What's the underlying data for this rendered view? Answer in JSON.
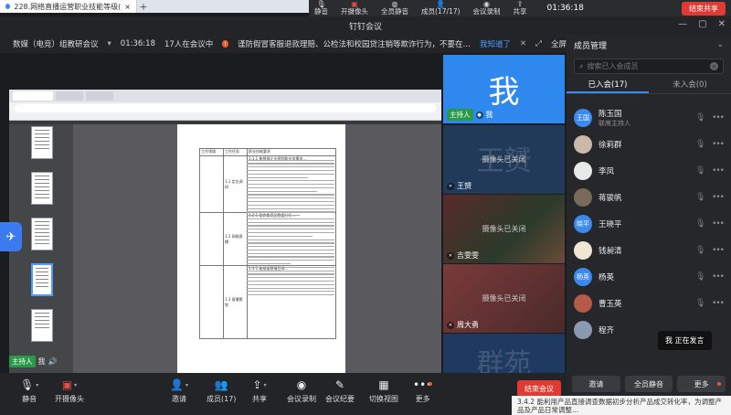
{
  "browser": {
    "tab_title": "228.网络直播运营职业技能等级(",
    "new_tab": "+"
  },
  "topbar": {
    "items": [
      {
        "icon": "mic-icon",
        "label": "静音"
      },
      {
        "icon": "camera-icon",
        "label": "开摄像头"
      },
      {
        "icon": "mute-all-icon",
        "label": "全员静音"
      },
      {
        "icon": "members-icon",
        "label": "成员(17/17)"
      },
      {
        "icon": "record-icon",
        "label": "会议录制"
      },
      {
        "icon": "share-icon",
        "label": "共享"
      }
    ],
    "time": "01:36:18",
    "end_share": "结束共享"
  },
  "window": {
    "title": "钉钉会议"
  },
  "infobar": {
    "meeting_name": "数媒（电竞）组教研会议",
    "time": "01:36:18",
    "count": "17人在会议中",
    "warning": "谨防假冒客服退款理赔、公检法和校园贷注销等欺诈行为，不要在“共享屏幕”时…",
    "ack": "我知道了",
    "fullscreen": "全屏"
  },
  "shared_doc": {
    "rows": [
      [
        "工作领域",
        "工作任务",
        "职业技能要求"
      ],
      [
        "",
        "1.1 定位调研",
        "1.1.1 能根据企业规划和业务需求…"
      ],
      [
        "",
        "1.2 网络直播",
        "1.2.1 能收集竞品数据分析…"
      ],
      [
        "",
        "1.3 直播策划",
        "1.3.1 能根据直播目标…"
      ]
    ]
  },
  "sharer": {
    "badge": "主持人",
    "name": "我"
  },
  "videos": [
    {
      "big": "我",
      "badge": "主持人",
      "name": "我",
      "cam_off": ""
    },
    {
      "big": "王赟",
      "badge": "",
      "name": "王赟",
      "cam_off": "摄像头已关闭"
    },
    {
      "big": "",
      "badge": "",
      "name": "吉雯雯",
      "cam_off": "摄像头已关闭"
    },
    {
      "big": "",
      "badge": "",
      "name": "周大勇",
      "cam_off": "摄像头已关闭"
    },
    {
      "big": "群苑",
      "badge": "",
      "name": "",
      "cam_off": ""
    }
  ],
  "panel": {
    "title": "成员管理",
    "search_placeholder": "搜索已入会成员",
    "tab_joined": "已入会(17)",
    "tab_not_joined": "未入会(0)",
    "members": [
      {
        "avatar": "王国",
        "name": "陈玉国",
        "sub": "联席主持人"
      },
      {
        "avatar": "",
        "name": "徐莉群",
        "sub": ""
      },
      {
        "avatar": "",
        "name": "李凤",
        "sub": ""
      },
      {
        "avatar": "",
        "name": "蒋骏帆",
        "sub": ""
      },
      {
        "avatar": "晓平",
        "name": "王晓平",
        "sub": ""
      },
      {
        "avatar": "",
        "name": "钱昶清",
        "sub": ""
      },
      {
        "avatar": "杨英",
        "name": "杨英",
        "sub": ""
      },
      {
        "avatar": "",
        "name": "曹玉英",
        "sub": ""
      },
      {
        "avatar": "",
        "name": "程齐",
        "sub": ""
      }
    ],
    "btn_invite": "邀请",
    "btn_mute_all": "全员静音",
    "btn_more": "更多"
  },
  "speaking": "我  正在发言",
  "toolbar": {
    "mute": "静音",
    "camera": "开摄像头",
    "invite": "邀请",
    "members": "成员(17)",
    "share": "共享",
    "record": "会议录制",
    "minutes": "会议纪要",
    "layout": "切换视图",
    "more": "更多",
    "end": "结束会议"
  },
  "bg_doc_text": "3.4.2 能利用产品直接调查数据初步分析产品成交转化率，为调整产品及产品日常调整..."
}
